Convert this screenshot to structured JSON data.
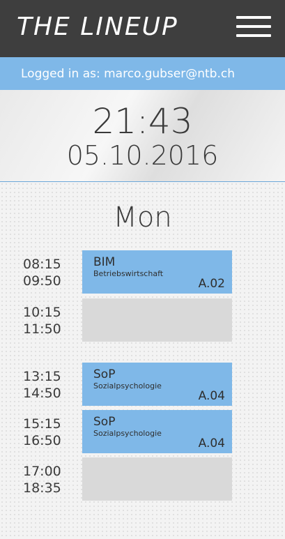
{
  "header": {
    "logo": "THE LINEUP",
    "menu_icon": "hamburger-menu-icon"
  },
  "login": {
    "label": "Logged in as:",
    "email": "marco.gubser@ntb.ch"
  },
  "clock": {
    "time": "21:43",
    "date": "05.10.2016"
  },
  "schedule": {
    "day": "Mon",
    "slots": [
      {
        "start": "08:15",
        "end": "09:50",
        "code": "BIM",
        "name": "Betriebswirtschaft",
        "room": "A.02"
      },
      {
        "start": "10:15",
        "end": "11:50"
      },
      {
        "start": "13:15",
        "end": "14:50",
        "code": "SoP",
        "name": "Sozialpsychologie",
        "room": "A.04"
      },
      {
        "start": "15:15",
        "end": "16:50",
        "code": "SoP",
        "name": "Sozialpsychologie",
        "room": "A.04"
      },
      {
        "start": "17:00",
        "end": "18:35"
      }
    ]
  },
  "colors": {
    "header_bg": "#3e3e3e",
    "accent_blue": "#7fb8e8",
    "empty_slot": "#d9d9d9"
  }
}
